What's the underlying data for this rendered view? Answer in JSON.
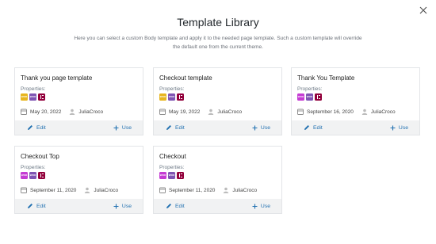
{
  "dialog": {
    "title": "Template Library",
    "description": "Here you can select a custom Body template and apply it to the needed page template. Such a custom template will override the default one from the current theme."
  },
  "common": {
    "properties_label": "Properties:",
    "edit_label": "Edit",
    "use_label": "Use",
    "accent_color": "#2271b1"
  },
  "templates": [
    {
      "name": "Thank you page template",
      "date": "May 20, 2022",
      "author": "JuliaCroco",
      "badges": [
        "yellow",
        "purple",
        "elementor"
      ]
    },
    {
      "name": "Checkout template",
      "date": "May 19, 2022",
      "author": "JuliaCroco",
      "badges": [
        "yellow",
        "purple",
        "elementor"
      ]
    },
    {
      "name": "Thank You Template",
      "date": "September 16, 2020",
      "author": "JuliaCroco",
      "badges": [
        "magenta",
        "purple",
        "elementor"
      ]
    },
    {
      "name": "Checkout Top",
      "date": "September 11, 2020",
      "author": "JuliaCroco",
      "badges": [
        "magenta",
        "purple",
        "elementor"
      ]
    },
    {
      "name": "Checkout",
      "date": "September 11, 2020",
      "author": "JuliaCroco",
      "badges": [
        "magenta",
        "purple",
        "elementor"
      ]
    }
  ]
}
